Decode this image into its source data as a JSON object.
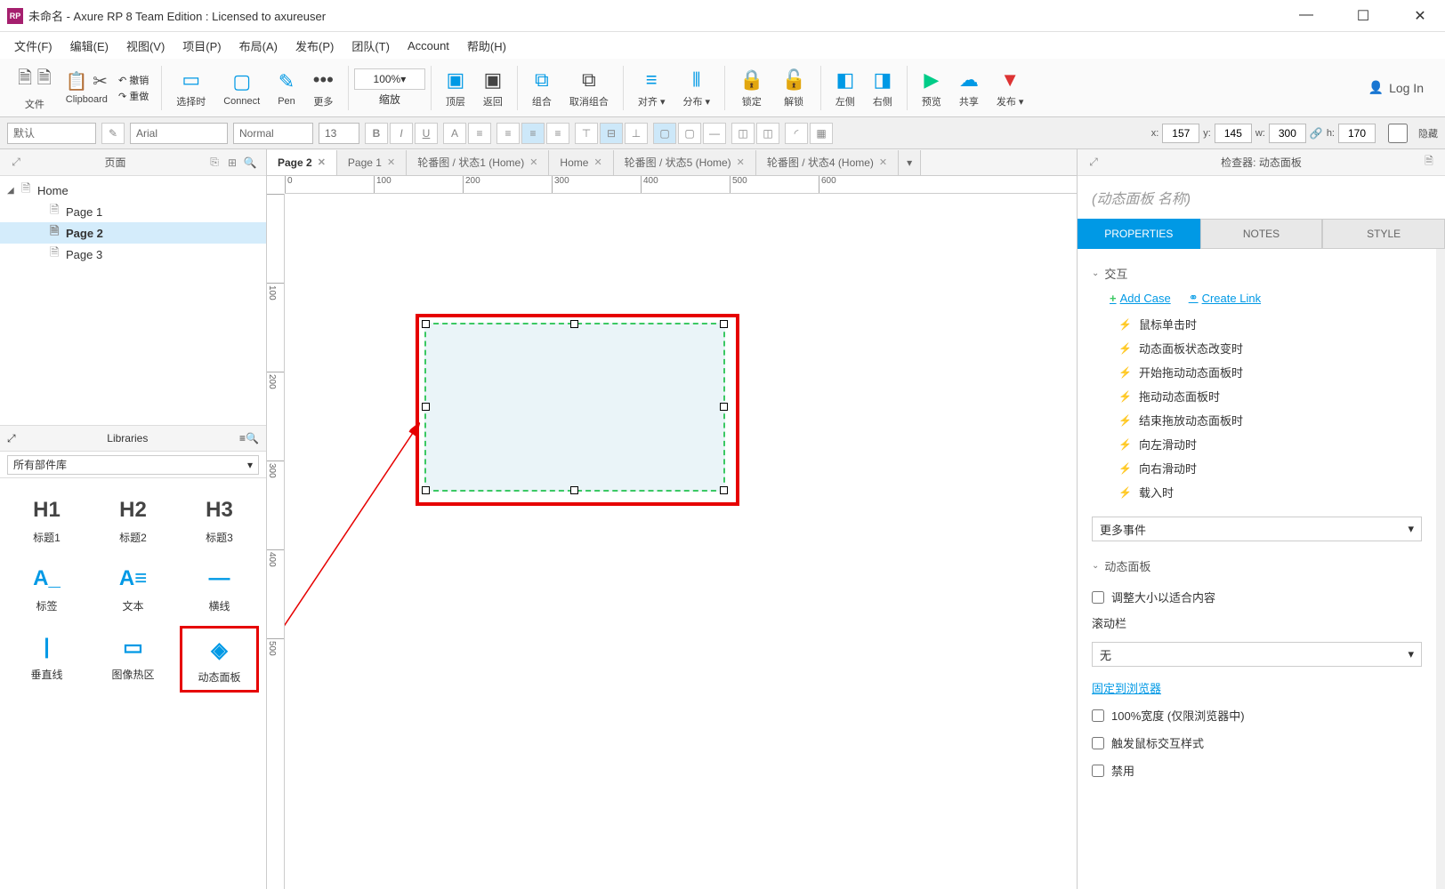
{
  "titlebar": {
    "title": "未命名 - Axure RP 8 Team Edition : Licensed to axureuser"
  },
  "menubar": {
    "file": "文件(F)",
    "edit": "编辑(E)",
    "view": "视图(V)",
    "project": "项目(P)",
    "arrange": "布局(A)",
    "publish": "发布(P)",
    "team": "团队(T)",
    "account": "Account",
    "help": "帮助(H)"
  },
  "toolbar": {
    "file_label": "文件",
    "clipboard_label": "Clipboard",
    "undo": "撤销",
    "redo": "重做",
    "select": "选择时",
    "connect": "Connect",
    "pen": "Pen",
    "more": "更多",
    "zoom_label": "缩放",
    "zoom_value": "100%",
    "front": "顶层",
    "back": "返回",
    "group": "组合",
    "ungroup": "取消组合",
    "align": "对齐",
    "distribute": "分布",
    "lock": "锁定",
    "unlock": "解锁",
    "left": "左侧",
    "right": "右侧",
    "preview": "预览",
    "share": "共享",
    "publish": "发布",
    "login": "Log In"
  },
  "formatbar": {
    "style": "默认",
    "font": "Arial",
    "weight": "Normal",
    "size": "13",
    "coords": {
      "x_label": "x:",
      "x": "157",
      "y_label": "y:",
      "y": "145",
      "w_label": "w:",
      "w": "300",
      "h_label": "h:",
      "h": "170",
      "hide": "隐藏"
    }
  },
  "pages_panel": {
    "title": "页面",
    "items": [
      {
        "label": "Home",
        "indent": 0,
        "expanded": true
      },
      {
        "label": "Page 1",
        "indent": 1
      },
      {
        "label": "Page 2",
        "indent": 1,
        "selected": true
      },
      {
        "label": "Page 3",
        "indent": 1
      }
    ]
  },
  "libraries_panel": {
    "title": "Libraries",
    "select_label": "所有部件库",
    "widgets": [
      {
        "icon": "H1",
        "label": "标题1"
      },
      {
        "icon": "H2",
        "label": "标题2"
      },
      {
        "icon": "H3",
        "label": "标题3"
      },
      {
        "icon": "A_",
        "label": "标签",
        "blue": true
      },
      {
        "icon": "A≡",
        "label": "文本",
        "blue": true
      },
      {
        "icon": "—",
        "label": "横线",
        "blue": true
      },
      {
        "icon": "|",
        "label": "垂直线",
        "blue": true
      },
      {
        "icon": "▭",
        "label": "图像热区",
        "blue": true
      },
      {
        "icon": "◈",
        "label": "动态面板",
        "blue": true,
        "highlighted": true
      }
    ]
  },
  "tabs": [
    {
      "label": "Page 2",
      "active": true
    },
    {
      "label": "Page 1"
    },
    {
      "label": "轮番图 / 状态1 (Home)"
    },
    {
      "label": "Home"
    },
    {
      "label": "轮番图 / 状态5 (Home)"
    },
    {
      "label": "轮番图 / 状态4 (Home)"
    }
  ],
  "ruler_ticks_h": [
    "0",
    "100",
    "200",
    "300",
    "400",
    "500",
    "600"
  ],
  "ruler_ticks_v": [
    "",
    "100",
    "200",
    "300",
    "400",
    "500"
  ],
  "inspector": {
    "header": "检查器: 动态面板",
    "name_placeholder": "(动态面板 名称)",
    "tabs": {
      "properties": "PROPERTIES",
      "notes": "NOTES",
      "style": "STYLE"
    },
    "interactions_header": "交互",
    "add_case": "Add Case",
    "create_link": "Create Link",
    "events": [
      "鼠标单击时",
      "动态面板状态改变时",
      "开始拖动动态面板时",
      "拖动动态面板时",
      "结束拖放动态面板时",
      "向左滑动时",
      "向右滑动时",
      "载入时"
    ],
    "more_events": "更多事件",
    "dp_header": "动态面板",
    "fit_content": "调整大小以适合内容",
    "scrollbar_label": "滚动栏",
    "scrollbar_value": "无",
    "pin_browser": "固定到浏览器",
    "full_width": "100%宽度 (仅限浏览器中)",
    "trigger_hover": "触发鼠标交互样式",
    "disabled": "禁用"
  }
}
